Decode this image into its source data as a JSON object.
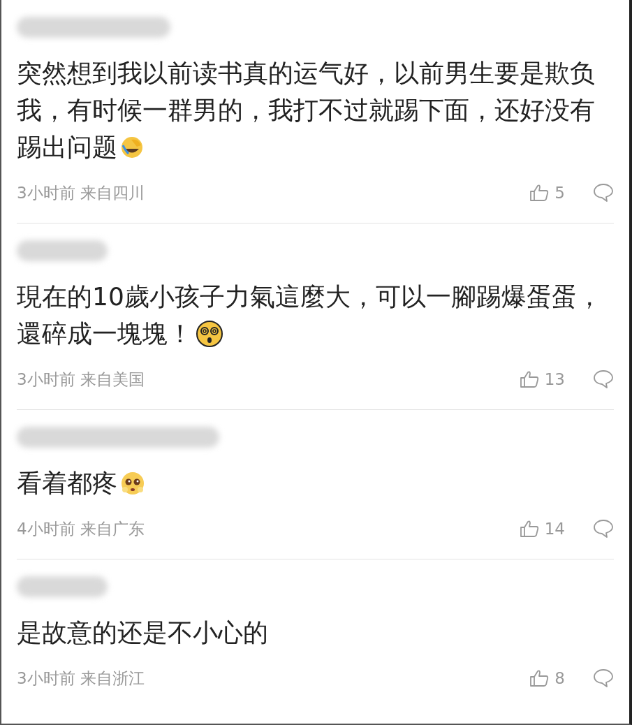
{
  "comments": [
    {
      "lines": [
        "突然想到我以前读书真的运气好，以前男生要是欺负",
        "我，有时候一群男的，我打不过就踢下面，还好没有",
        "踢出问题"
      ],
      "emoji": {
        "kind": "laugh-cry"
      },
      "time": "3小时前",
      "location": "来自四川",
      "likes": "5"
    },
    {
      "lines": [
        "現在的10歲小孩子力氣這麼大，可以一腳踢爆蛋蛋，",
        "還碎成一塊塊！"
      ],
      "emoji": {
        "kind": "dizzy"
      },
      "time": "3小时前",
      "location": "来自美国",
      "likes": "13"
    },
    {
      "lines": [
        "看着都疼"
      ],
      "emoji": {
        "kind": "pleading"
      },
      "time": "4小时前",
      "location": "来自广东",
      "likes": "14"
    },
    {
      "lines": [
        "是故意的还是不小心的"
      ],
      "time": "3小时前",
      "location": "来自浙江",
      "likes": "8"
    }
  ]
}
